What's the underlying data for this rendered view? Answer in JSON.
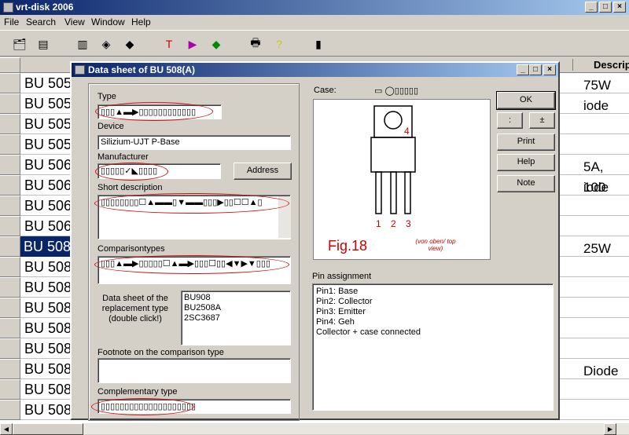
{
  "window": {
    "title": "vrt-disk 2006"
  },
  "menu": [
    "File",
    "Search",
    "View",
    "Window",
    "Help"
  ],
  "grid": {
    "column_header": "Descript",
    "rows": [
      {
        "name": "BU 505",
        "desc": "75W"
      },
      {
        "name": "BU 505",
        "desc": "iode"
      },
      {
        "name": "BU 505",
        "desc": ""
      },
      {
        "name": "BU 505",
        "desc": ""
      },
      {
        "name": "BU 506",
        "desc": "5A, 100"
      },
      {
        "name": "BU 506",
        "desc": "iode"
      },
      {
        "name": "BU 506",
        "desc": ""
      },
      {
        "name": "BU 506",
        "desc": ""
      },
      {
        "name": "BU 508",
        "desc": "25W",
        "selected": true
      },
      {
        "name": "BU 508",
        "desc": ""
      },
      {
        "name": "BU 508",
        "desc": ""
      },
      {
        "name": "BU 508",
        "desc": ""
      },
      {
        "name": "BU 508",
        "desc": ""
      },
      {
        "name": "BU 508",
        "desc": ""
      },
      {
        "name": "BU 508",
        "desc": "Diode"
      },
      {
        "name": "BU 508",
        "desc": ""
      },
      {
        "name": "BU 508",
        "desc": ""
      }
    ]
  },
  "dialog": {
    "title": "Data sheet of BU 508(A)",
    "type_label": "Type",
    "type_value": "▯▯▯▲▬▶▯▯▯▯▯▯▯▯▯▯▯▯",
    "device_label": "Device",
    "device_value": "Silizium-UJT P-Base",
    "manufacturer_label": "Manufacturer",
    "manufacturer_value": "▯▯▯▯▯✓◣▯▯▯▯",
    "address_button": "Address",
    "short_desc_label": "Short description",
    "short_desc_value": "▯▯▯▯▯▯▯▯☐▲▬▬▯▼▬▬▯▯▯▶▯▯☐☐▲▯",
    "comparison_label": "Comparisontypes",
    "comparison_value": "▯▯▯▲▬▶▯▯▯▯▯☐▲▬▶▯▯▯☐▯▯◀▼▶▼▯▯▯",
    "replacement_label": "Data sheet of the replacement type (double click!)",
    "replacements": [
      "BU908",
      "BU2508A",
      "2SC3687"
    ],
    "footnote_label": "Footnote on the comparison type",
    "footnote_value": "",
    "complementary_label": "Complementary type",
    "complementary_value": "▯▯▯▯▯▯▯▯▯▯▯▯▯▯▯▯▯▯▯▯",
    "case_label": "Case:",
    "case_value": "▭ ◯▯▯▯▯▯",
    "figure_label": "Fig.18",
    "pin_numbers": [
      "1",
      "2",
      "3",
      "4"
    ],
    "view_note": "(von oben/ top view)",
    "pin_label": "Pin assignment",
    "pins": [
      "Pin1: Base",
      "Pin2: Collector",
      "Pin3: Emitter",
      "Pin4: Geh",
      "Collector + case connected"
    ],
    "buttons": {
      "ok": "OK",
      "prev": ":",
      "plus": "±",
      "print": "Print",
      "help": "Help",
      "note": "Note"
    }
  }
}
